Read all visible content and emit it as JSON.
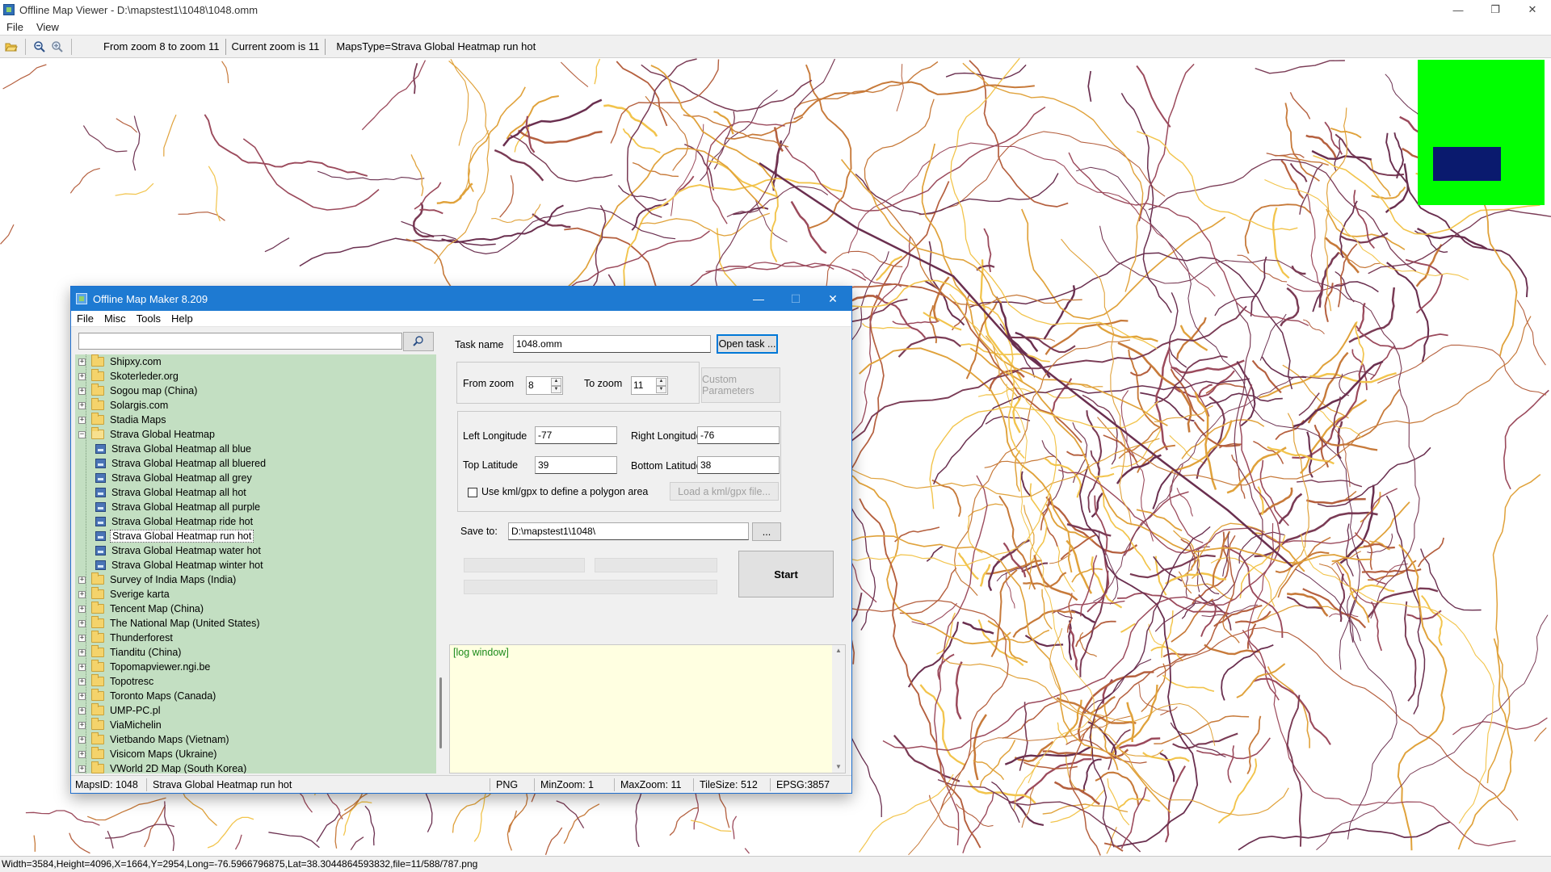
{
  "viewer": {
    "title": "Offline Map Viewer - D:\\mapstest1\\1048\\1048.omm",
    "menu": [
      "File",
      "View"
    ],
    "toolbar": {
      "zoom_range": "From zoom 8 to zoom 11",
      "current_zoom": "Current zoom is 11",
      "maps_type": "MapsType=Strava Global Heatmap run hot"
    },
    "status": "Width=3584,Height=4096,X=1664,Y=2954,Long=-76.5966796875,Lat=38.3044864593832,file=11/588/787.png",
    "overview_colors": {
      "background": "#00ff00",
      "viewport": "#0a1a6e"
    },
    "icons": [
      "open-folder-icon",
      "zoom-out-icon",
      "zoom-in-icon"
    ]
  },
  "maker": {
    "title": "Offline Map Maker 8.209",
    "menu": [
      "File",
      "Misc",
      "Tools",
      "Help"
    ],
    "search": {
      "value": "",
      "placeholder": ""
    },
    "tree": [
      {
        "label": "Shipxy.com",
        "type": "folder",
        "expanded": false
      },
      {
        "label": "Skoterleder.org",
        "type": "folder",
        "expanded": false
      },
      {
        "label": "Sogou map (China)",
        "type": "folder",
        "expanded": false
      },
      {
        "label": "Solargis.com",
        "type": "folder",
        "expanded": false
      },
      {
        "label": "Stadia Maps",
        "type": "folder",
        "expanded": false
      },
      {
        "label": "Strava Global Heatmap",
        "type": "folder",
        "expanded": true
      },
      {
        "label": "Strava Global Heatmap all blue",
        "type": "map"
      },
      {
        "label": "Strava Global Heatmap all bluered",
        "type": "map"
      },
      {
        "label": "Strava Global Heatmap all grey",
        "type": "map"
      },
      {
        "label": "Strava Global Heatmap all hot",
        "type": "map"
      },
      {
        "label": "Strava Global Heatmap all purple",
        "type": "map"
      },
      {
        "label": "Strava Global Heatmap ride hot",
        "type": "map"
      },
      {
        "label": "Strava Global Heatmap run hot",
        "type": "map",
        "selected": true
      },
      {
        "label": "Strava Global Heatmap water hot",
        "type": "map"
      },
      {
        "label": "Strava Global Heatmap winter hot",
        "type": "map"
      },
      {
        "label": "Survey of India Maps (India)",
        "type": "folder",
        "expanded": false
      },
      {
        "label": "Sverige karta",
        "type": "folder",
        "expanded": false
      },
      {
        "label": "Tencent Map (China)",
        "type": "folder",
        "expanded": false
      },
      {
        "label": "The National Map (United States)",
        "type": "folder",
        "expanded": false
      },
      {
        "label": "Thunderforest",
        "type": "folder",
        "expanded": false
      },
      {
        "label": "Tianditu (China)",
        "type": "folder",
        "expanded": false
      },
      {
        "label": "Topomapviewer.ngi.be",
        "type": "folder",
        "expanded": false
      },
      {
        "label": "Topotresc",
        "type": "folder",
        "expanded": false
      },
      {
        "label": "Toronto Maps (Canada)",
        "type": "folder",
        "expanded": false
      },
      {
        "label": "UMP-PC.pl",
        "type": "folder",
        "expanded": false
      },
      {
        "label": "ViaMichelin",
        "type": "folder",
        "expanded": false
      },
      {
        "label": "Vietbando Maps (Vietnam)",
        "type": "folder",
        "expanded": false
      },
      {
        "label": "Visicom Maps (Ukraine)",
        "type": "folder",
        "expanded": false
      },
      {
        "label": "VWorld 2D Map (South Korea)",
        "type": "folder",
        "expanded": false
      }
    ],
    "task_name_label": "Task name",
    "task_name": "1048.omm",
    "open_task": "Open task ...",
    "from_zoom_label": "From zoom",
    "from_zoom": "8",
    "to_zoom_label": "To zoom",
    "to_zoom": "11",
    "custom_params": "Custom Parameters",
    "left_lon_label": "Left Longitude",
    "left_lon": "-77",
    "right_lon_label": "Right Longitude",
    "right_lon": "-76",
    "top_lat_label": "Top Latitude",
    "top_lat": "39",
    "bottom_lat_label": "Bottom Latitude",
    "bottom_lat": "38",
    "kml_checkbox_label": "Use kml/gpx to define a polygon area",
    "kml_checked": false,
    "load_kml": "Load a kml/gpx file...",
    "save_to_label": "Save to:",
    "save_to": "D:\\mapstest1\\1048\\",
    "browse": "...",
    "start": "Start",
    "log": "[log window]",
    "status": {
      "maps_id": "MapsID: 1048",
      "map_name": "Strava Global Heatmap run hot",
      "format": "PNG",
      "min_zoom": "MinZoom: 1",
      "max_zoom": "MaxZoom: 11",
      "tile_size": "TileSize: 512",
      "epsg": "EPSG:3857"
    },
    "colors": {
      "tree_bg": "#c3dfc2",
      "log_bg": "#ffffe1",
      "title_bar": "#1e7ad2"
    }
  }
}
